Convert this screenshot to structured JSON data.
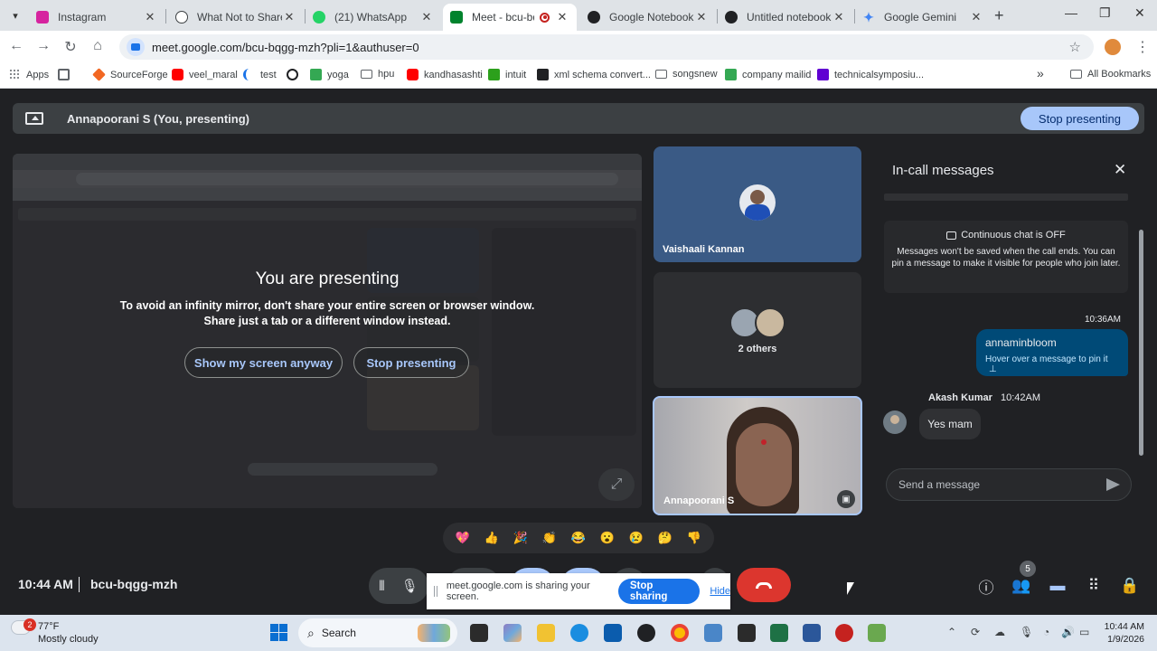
{
  "browser": {
    "tabs": [
      {
        "title": "Instagram",
        "favicon": "instagram-icon",
        "color": "#d6249f"
      },
      {
        "title": "What Not to Share",
        "favicon": "chatgpt-icon",
        "color": "#3c4043"
      },
      {
        "title": "(21) WhatsApp",
        "favicon": "whatsapp-icon",
        "color": "#25d366",
        "badge": "21"
      },
      {
        "title": "Meet - bcu-bqgg",
        "favicon": "meet-icon",
        "color": "#00832d"
      },
      {
        "title": "Google NotebookLM",
        "favicon": "notebooklm-icon",
        "color": "#202124"
      },
      {
        "title": "Untitled notebook - ",
        "favicon": "notebooklm-icon",
        "color": "#202124"
      },
      {
        "title": "Google Gemini",
        "favicon": "gemini-icon",
        "color": "#4285f4"
      }
    ],
    "url": "meet.google.com/bcu-bqgg-mzh?pli=1&authuser=0",
    "bookmarks": [
      {
        "label": "Apps",
        "icon": "apps-icon",
        "color": "#5f6368"
      },
      {
        "label": "",
        "icon": "grid-icon",
        "color": "#5f6368"
      },
      {
        "label": "SourceForge",
        "icon": "sourceforge-icon",
        "color": "#f26722"
      },
      {
        "label": "veel_maral",
        "icon": "youtube-icon",
        "color": "#ff0000"
      },
      {
        "label": "test",
        "icon": "moon-icon",
        "color": "#1a73e8"
      },
      {
        "label": "",
        "icon": "globe-icon",
        "color": "#202124"
      },
      {
        "label": "yoga",
        "icon": "yoga-icon",
        "color": "#34a853"
      },
      {
        "label": "hpu",
        "icon": "folder-icon",
        "color": "#5f6368"
      },
      {
        "label": "kandhasashti",
        "icon": "youtube-icon",
        "color": "#ff0000"
      },
      {
        "label": "intuit",
        "icon": "intuit-icon",
        "color": "#2ca01c"
      },
      {
        "label": "xml schema convert...",
        "icon": "sf-icon",
        "color": "#202124"
      },
      {
        "label": "songsnew",
        "icon": "folder-icon",
        "color": "#5f6368"
      },
      {
        "label": "company mailid",
        "icon": "sheet-icon",
        "color": "#34a853"
      },
      {
        "label": "technicalsymposiu...",
        "icon": "yahoo-icon",
        "color": "#6001d2"
      }
    ],
    "more_bookmarks": "»",
    "all_bookmarks": "All Bookmarks"
  },
  "meet": {
    "presenting_banner": "Annapoorani S (You, presenting)",
    "stop_presenting": "Stop presenting",
    "preview": {
      "title": "You are presenting",
      "desc_line1": "To avoid an infinity mirror, don't share your entire screen or browser window.",
      "desc_line2": "Share just a tab or a different window instead.",
      "show_anyway": "Show my screen anyway",
      "stop_presenting": "Stop presenting"
    },
    "participants": [
      {
        "name": "Vaishaali Kannan"
      },
      {
        "name": "2 others"
      },
      {
        "name": "Annapoorani S"
      }
    ],
    "chat": {
      "title": "In-call messages",
      "info_head": "Continuous chat is OFF",
      "info_body": "Messages won't be saved when the call ends. You can pin a message to make it visible for people who join later.",
      "time1": "10:36AM",
      "my_message": "annaminbloom",
      "my_hint": "Hover over a message to pin it",
      "sender": "Akash Kumar",
      "sender_time": "10:42AM",
      "other_message": "Yes mam",
      "input_placeholder": "Send a message"
    },
    "reactions": [
      "💖",
      "👍",
      "🎉",
      "👏",
      "😂",
      "😮",
      "😢",
      "🤔",
      "👎"
    ],
    "time": "10:44 AM",
    "meeting_code": "bcu-bqgg-mzh",
    "people_count": "5",
    "share_toast": {
      "text": "meet.google.com is sharing your screen.",
      "stop": "Stop sharing",
      "hide": "Hide"
    }
  },
  "taskbar": {
    "weather_badge": "2",
    "temp": "77°F",
    "condition": "Mostly cloudy",
    "search": "Search",
    "clock_time": "10:44 AM",
    "clock_date": "1/9/2026"
  }
}
